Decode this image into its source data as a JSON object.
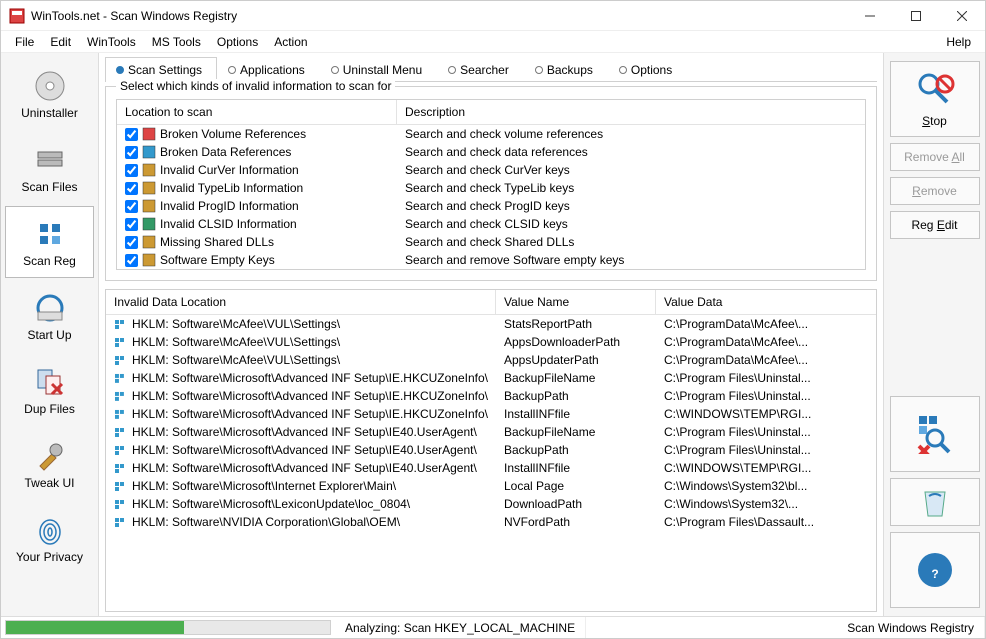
{
  "title": "WinTools.net - Scan Windows Registry",
  "menu": [
    "File",
    "Edit",
    "WinTools",
    "MS Tools",
    "Options",
    "Action"
  ],
  "menuRight": "Help",
  "leftNav": [
    {
      "label": "Uninstaller"
    },
    {
      "label": "Scan Files"
    },
    {
      "label": "Scan Reg",
      "active": true
    },
    {
      "label": "Start Up"
    },
    {
      "label": "Dup Files"
    },
    {
      "label": "Tweak UI"
    },
    {
      "label": "Your Privacy"
    }
  ],
  "tabs": [
    {
      "label": "Scan Settings",
      "active": true
    },
    {
      "label": "Applications"
    },
    {
      "label": "Uninstall Menu"
    },
    {
      "label": "Searcher"
    },
    {
      "label": "Backups"
    },
    {
      "label": "Options"
    }
  ],
  "groupLegend": "Select which kinds of invalid information to scan for",
  "scanCols": {
    "c1": "Location to scan",
    "c2": "Description"
  },
  "scanRows": [
    {
      "name": "Broken Volume References",
      "desc": "Search and check volume references"
    },
    {
      "name": "Broken Data References",
      "desc": "Search and check data references"
    },
    {
      "name": "Invalid CurVer Information",
      "desc": "Search and check CurVer keys"
    },
    {
      "name": "Invalid TypeLib Information",
      "desc": "Search and check TypeLib keys"
    },
    {
      "name": "Invalid ProgID Information",
      "desc": "Search and check ProgID keys"
    },
    {
      "name": "Invalid CLSID Information",
      "desc": "Search and check CLSID keys"
    },
    {
      "name": "Missing Shared DLLs",
      "desc": "Search and check Shared DLLs"
    },
    {
      "name": "Software Empty Keys",
      "desc": "Search and remove Software empty keys"
    }
  ],
  "resCols": {
    "c1": "Invalid Data Location",
    "c2": "Value Name",
    "c3": "Value Data"
  },
  "resRows": [
    {
      "loc": "HKLM: Software\\McAfee\\VUL\\Settings\\",
      "vn": "StatsReportPath",
      "vd": "C:\\ProgramData\\McAfee\\..."
    },
    {
      "loc": "HKLM: Software\\McAfee\\VUL\\Settings\\",
      "vn": "AppsDownloaderPath",
      "vd": "C:\\ProgramData\\McAfee\\..."
    },
    {
      "loc": "HKLM: Software\\McAfee\\VUL\\Settings\\",
      "vn": "AppsUpdaterPath",
      "vd": "C:\\ProgramData\\McAfee\\..."
    },
    {
      "loc": "HKLM: Software\\Microsoft\\Advanced INF Setup\\IE.HKCUZoneInfo\\",
      "vn": "BackupFileName",
      "vd": "C:\\Program Files\\Uninstal..."
    },
    {
      "loc": "HKLM: Software\\Microsoft\\Advanced INF Setup\\IE.HKCUZoneInfo\\",
      "vn": "BackupPath",
      "vd": "C:\\Program Files\\Uninstal..."
    },
    {
      "loc": "HKLM: Software\\Microsoft\\Advanced INF Setup\\IE.HKCUZoneInfo\\",
      "vn": "InstallINFfile",
      "vd": "C:\\WINDOWS\\TEMP\\RGI..."
    },
    {
      "loc": "HKLM: Software\\Microsoft\\Advanced INF Setup\\IE40.UserAgent\\",
      "vn": "BackupFileName",
      "vd": "C:\\Program Files\\Uninstal..."
    },
    {
      "loc": "HKLM: Software\\Microsoft\\Advanced INF Setup\\IE40.UserAgent\\",
      "vn": "BackupPath",
      "vd": "C:\\Program Files\\Uninstal..."
    },
    {
      "loc": "HKLM: Software\\Microsoft\\Advanced INF Setup\\IE40.UserAgent\\",
      "vn": "InstallINFfile",
      "vd": "C:\\WINDOWS\\TEMP\\RGI..."
    },
    {
      "loc": "HKLM: Software\\Microsoft\\Internet Explorer\\Main\\",
      "vn": "Local Page",
      "vd": "C:\\Windows\\System32\\bl..."
    },
    {
      "loc": "HKLM: Software\\Microsoft\\LexiconUpdate\\loc_0804\\",
      "vn": "DownloadPath",
      "vd": "C:\\Windows\\System32\\..."
    },
    {
      "loc": "HKLM: Software\\NVIDIA Corporation\\Global\\OEM\\",
      "vn": "NVFordPath",
      "vd": "C:\\Program Files\\Dassault..."
    }
  ],
  "right": {
    "stop": "Stop",
    "removeAll": "Remove All",
    "remove": "Remove",
    "regEdit": "Reg Edit"
  },
  "status": {
    "analyzing": "Analyzing:  Scan HKEY_LOCAL_MACHINE",
    "right": "Scan Windows Registry"
  }
}
